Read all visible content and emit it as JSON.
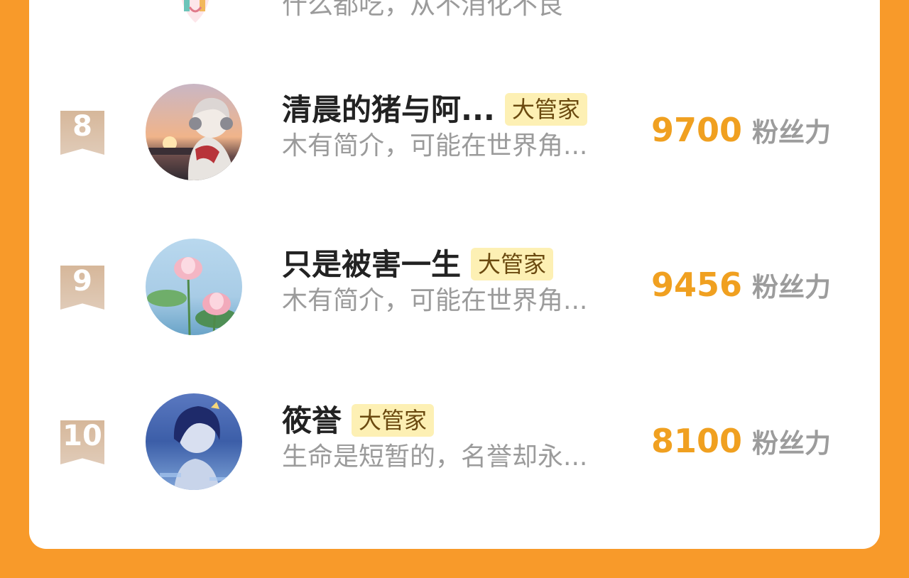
{
  "colors": {
    "background": "#f89a2a",
    "card": "#ffffff",
    "score": "#f0a020",
    "tag_bg": "#fdf0b4",
    "rank_badge": "#d6b79a"
  },
  "partial_row": {
    "bio": "什么都吃，从不消化不良"
  },
  "rows": [
    {
      "rank": "8",
      "name": "清晨的猪与阿...",
      "tag": "大管家",
      "bio": "木有简介，可能在世界角...",
      "score": "9700",
      "unit": "粉丝力",
      "avatar_icon": "avatar-headphones-boy"
    },
    {
      "rank": "9",
      "name": "只是被害一生",
      "tag": "大管家",
      "bio": "木有简介，可能在世界角...",
      "score": "9456",
      "unit": "粉丝力",
      "avatar_icon": "avatar-lotus"
    },
    {
      "rank": "10",
      "name": "筱誉",
      "tag": "大管家",
      "bio": "生命是短暂的，名誉却永...",
      "score": "8100",
      "unit": "粉丝力",
      "avatar_icon": "avatar-blue-hair"
    }
  ]
}
